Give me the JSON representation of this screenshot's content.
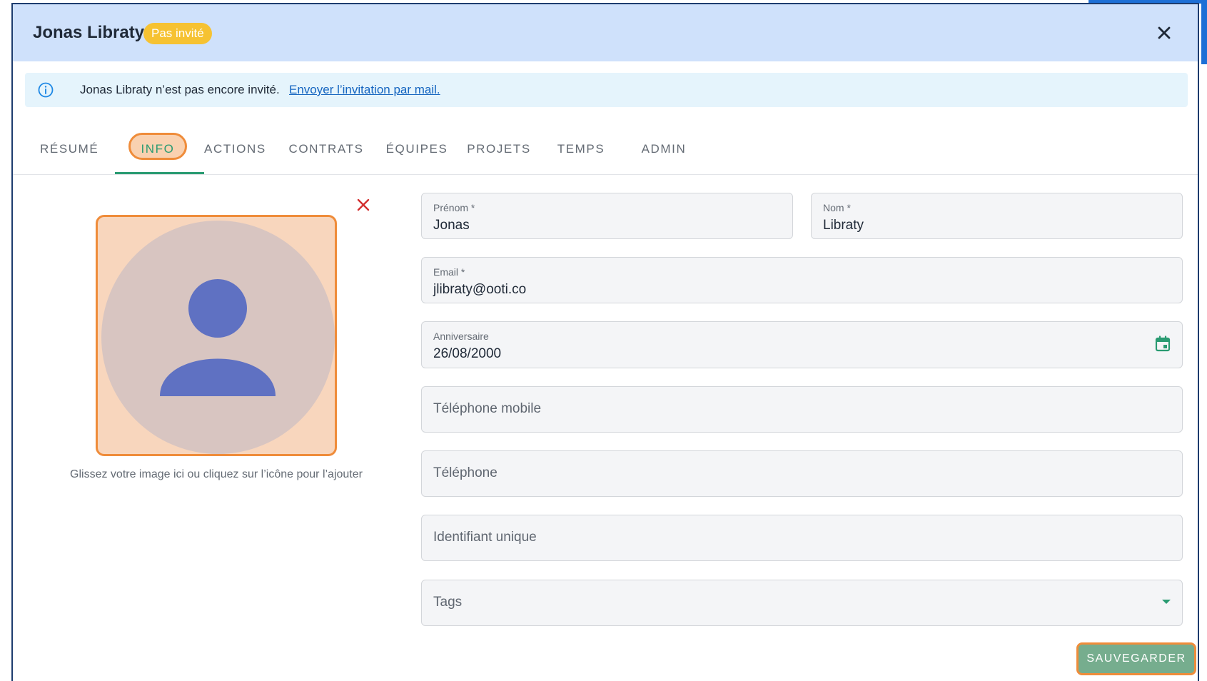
{
  "header": {
    "title": "Jonas Libraty",
    "badge": "Pas invité"
  },
  "alert": {
    "text": "Jonas Libraty n’est pas encore invité.",
    "link": "Envoyer l’invitation par mail."
  },
  "tabs": [
    {
      "label": "RÉSUMÉ"
    },
    {
      "label": "INFO",
      "active": true
    },
    {
      "label": "ACTIONS"
    },
    {
      "label": "CONTRATS"
    },
    {
      "label": "ÉQUIPES"
    },
    {
      "label": "PROJETS"
    },
    {
      "label": "TEMPS"
    },
    {
      "label": "ADMIN"
    }
  ],
  "avatar": {
    "hint": "Glissez votre image ici ou cliquez sur l’icône pour l’ajouter"
  },
  "form": {
    "prenom": {
      "label": "Prénom *",
      "value": "Jonas"
    },
    "nom": {
      "label": "Nom *",
      "value": "Libraty"
    },
    "email": {
      "label": "Email *",
      "value": "jlibraty@ooti.co"
    },
    "anniversaire": {
      "label": "Anniversaire",
      "value": "26/08/2000"
    },
    "telephone_mobile": {
      "placeholder": "Téléphone mobile"
    },
    "telephone": {
      "placeholder": "Téléphone"
    },
    "identifiant_unique": {
      "placeholder": "Identifiant unique"
    },
    "tags": {
      "placeholder": "Tags"
    }
  },
  "save_button": "SAUVEGARDER",
  "colors": {
    "header_bg": "#cfe1fb",
    "badge_bg": "#f6c232",
    "accent_green": "#2a9b72",
    "highlight_orange": "#ef8c3a",
    "alert_bg": "#e5f4fc",
    "link_blue": "#1565c0",
    "avatar_icon": "#5f71c2",
    "remove_red": "#d32f2f"
  },
  "icons": {
    "close": "close-icon",
    "info": "info-icon",
    "remove": "remove-image-icon",
    "calendar": "calendar-icon",
    "dropdown": "chevron-down-icon",
    "avatar": "user-placeholder-icon"
  }
}
